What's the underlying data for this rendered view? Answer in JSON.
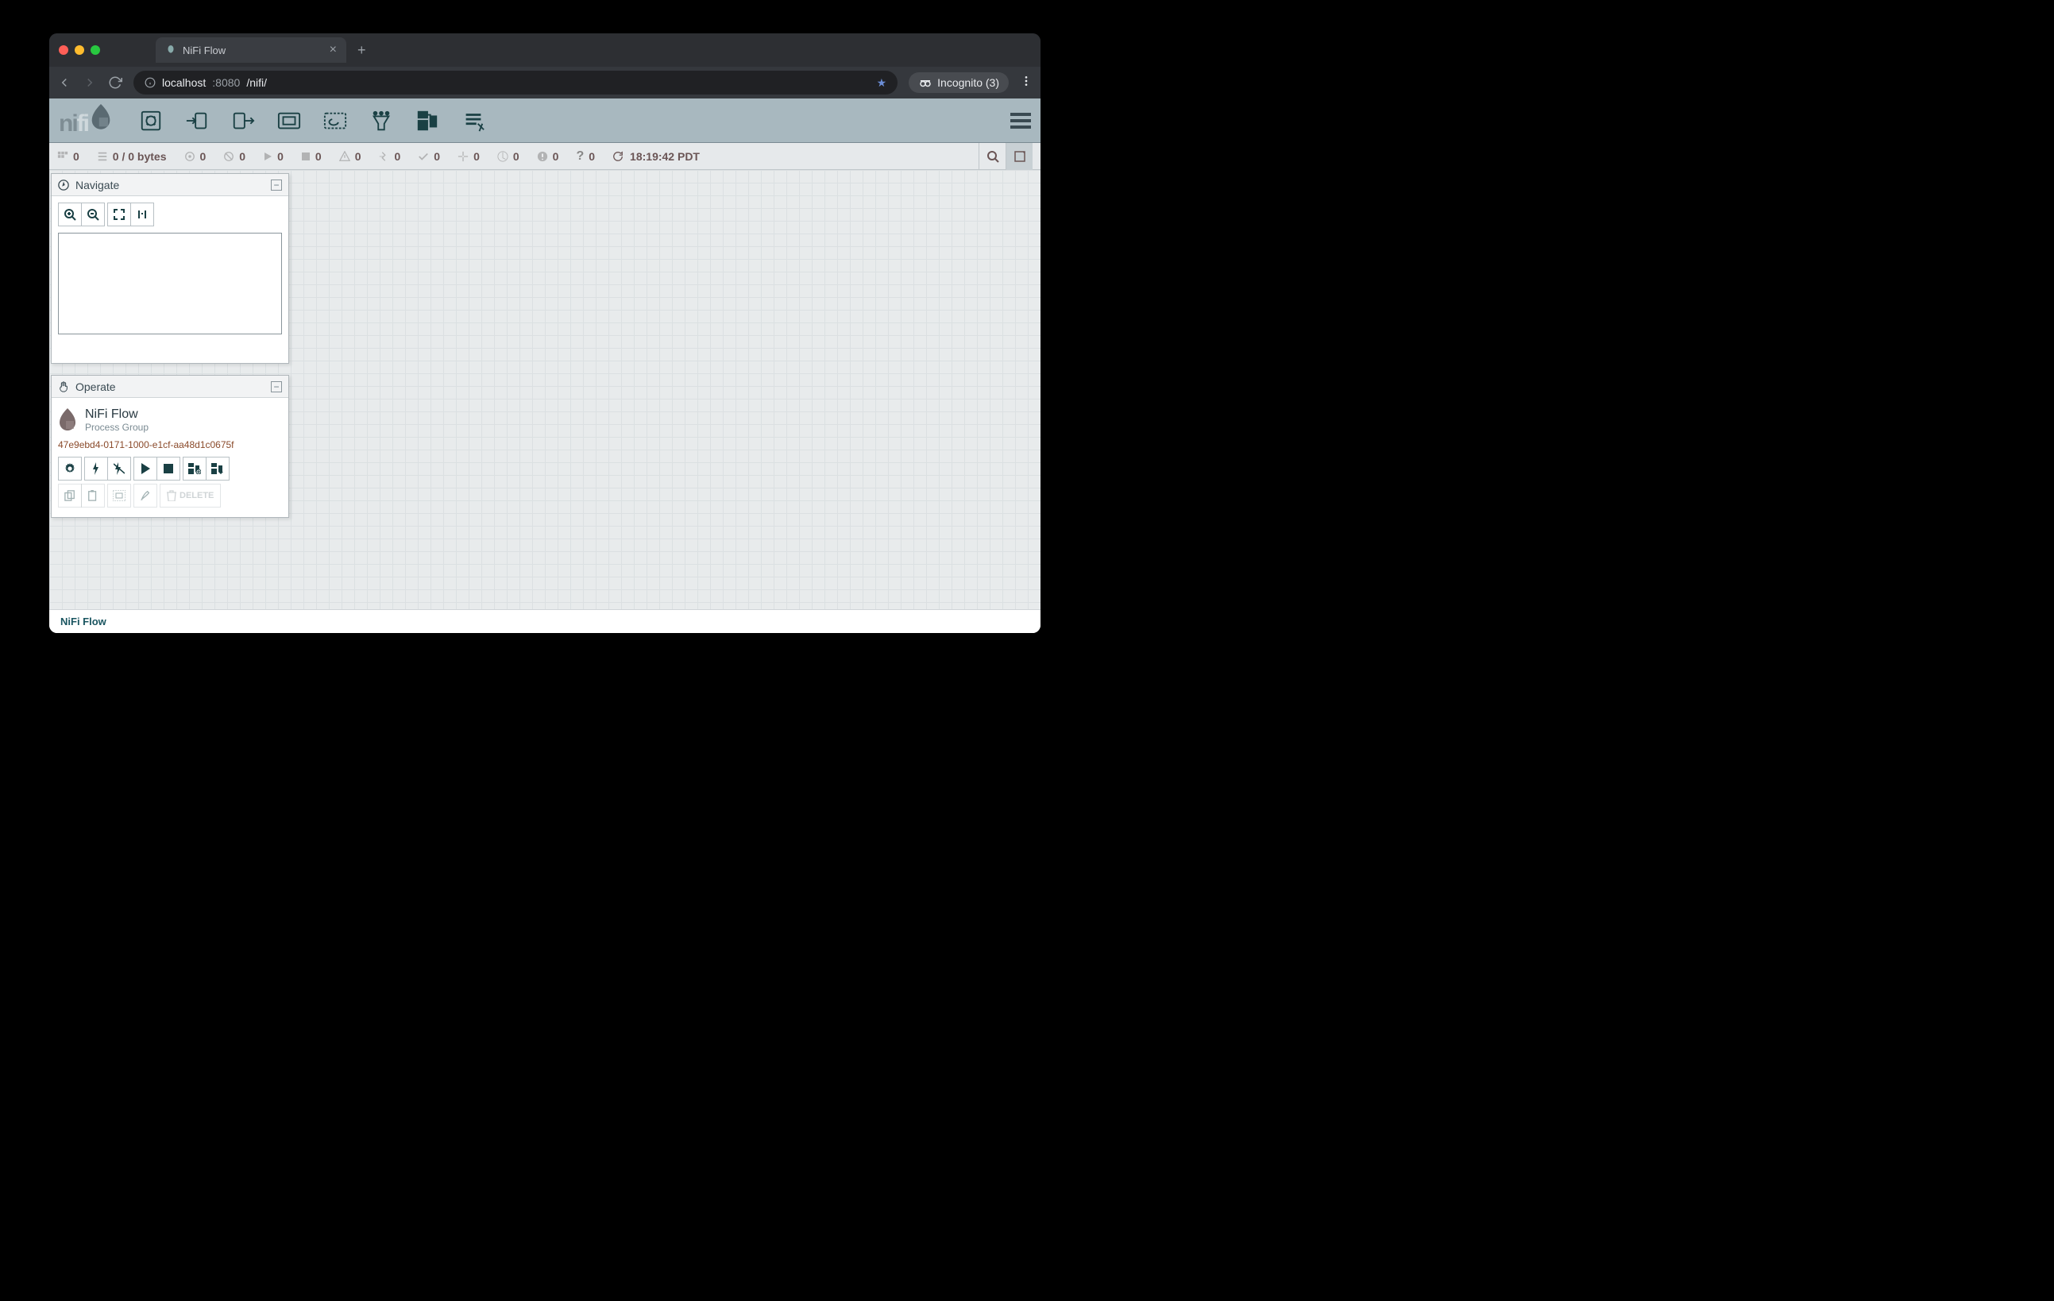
{
  "browser": {
    "tab_title": "NiFi Flow",
    "url_prefix": "localhost",
    "url_port": ":8080",
    "url_path": "/nifi/",
    "incognito_label": "Incognito (3)"
  },
  "status": {
    "active_threads": "0",
    "queued": "0 / 0 bytes",
    "transmitting": "0",
    "not_transmitting": "0",
    "running": "0",
    "stopped": "0",
    "invalid": "0",
    "disabled": "0",
    "up_to_date": "0",
    "locally_modified": "0",
    "stale": "0",
    "sync_failure": "0",
    "unknown": "0",
    "refresh_time": "18:19:42 PDT"
  },
  "panels": {
    "navigate_title": "Navigate",
    "operate_title": "Operate"
  },
  "operate": {
    "name": "NiFi Flow",
    "type": "Process Group",
    "id": "47e9ebd4-0171-1000-e1cf-aa48d1c0675f",
    "delete_label": "DELETE"
  },
  "breadcrumb": "NiFi Flow"
}
